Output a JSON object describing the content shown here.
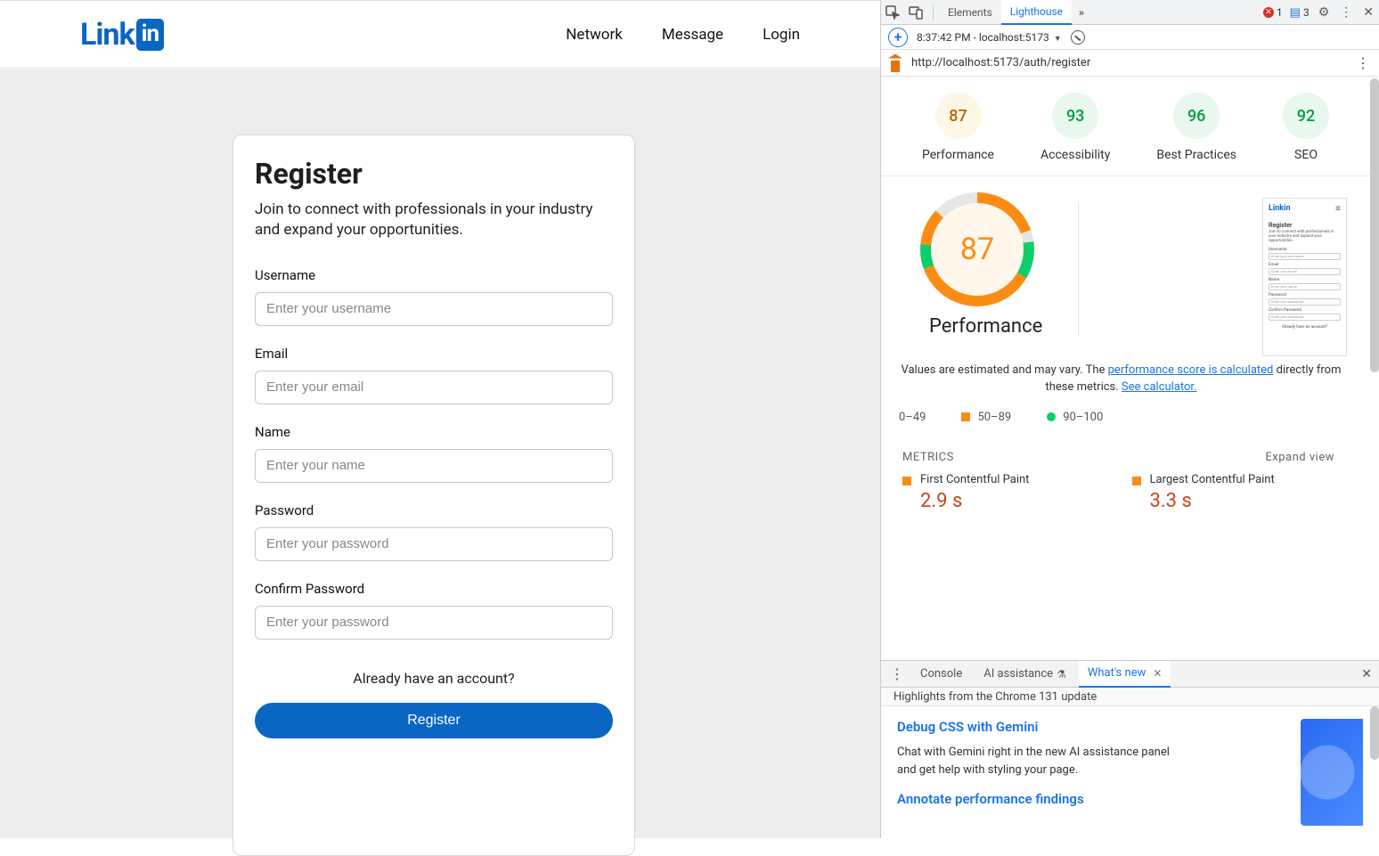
{
  "app": {
    "logo_text": "Link",
    "logo_badge": "in",
    "nav": [
      "Network",
      "Message",
      "Login"
    ]
  },
  "register": {
    "title": "Register",
    "subtitle": "Join to connect with professionals in your industry and expand your opportunities.",
    "fields": [
      {
        "label": "Username",
        "placeholder": "Enter your username"
      },
      {
        "label": "Email",
        "placeholder": "Enter your email"
      },
      {
        "label": "Name",
        "placeholder": "Enter your name"
      },
      {
        "label": "Password",
        "placeholder": "Enter your password"
      },
      {
        "label": "Confirm Password",
        "placeholder": "Enter your password"
      }
    ],
    "already": "Already have an account?",
    "button": "Register"
  },
  "devtools": {
    "tabs": {
      "elements": "Elements",
      "lighthouse": "Lighthouse",
      "more": "»"
    },
    "errors_count": "1",
    "messages_count": "3",
    "time_host": "8:37:42 PM - localhost:5173",
    "url": "http://localhost:5173/auth/register",
    "scores": [
      {
        "value": "87",
        "label": "Performance",
        "kind": "perf",
        "deg": "313deg"
      },
      {
        "value": "93",
        "label": "Accessibility",
        "kind": "green",
        "deg": "335deg"
      },
      {
        "value": "96",
        "label": "Best Practices",
        "kind": "green",
        "deg": "346deg"
      },
      {
        "value": "92",
        "label": "SEO",
        "kind": "green",
        "deg": "331deg"
      }
    ],
    "big_score": "87",
    "perf_heading": "Performance",
    "estimate_text_1": "Values are estimated and may vary. The ",
    "estimate_link_1": "performance score is calculated",
    "estimate_text_2": " directly from these metrics. ",
    "estimate_link_2": "See calculator.",
    "legend": {
      "range1": "0–49",
      "range2": "50–89",
      "range3": "90–100"
    },
    "metrics_label": "METRICS",
    "expand": "Expand view",
    "metrics": [
      {
        "title": "First Contentful Paint",
        "value": "2.9 s"
      },
      {
        "title": "Largest Contentful Paint",
        "value": "3.3 s"
      }
    ],
    "thumb": {
      "logo": "Linkin",
      "title": "Register",
      "sub": "Join to connect with professionals in your industry and expand your opportunities.",
      "already": "Already have an account?"
    },
    "drawer": {
      "tabs": {
        "console": "Console",
        "ai": "AI assistance",
        "whats_new": "What's new"
      },
      "highlights": "Highlights from the Chrome 131 update",
      "h1": "Debug CSS with Gemini",
      "p1": "Chat with Gemini right in the new AI assistance panel and get help with styling your page.",
      "h2": "Annotate performance findings"
    }
  }
}
